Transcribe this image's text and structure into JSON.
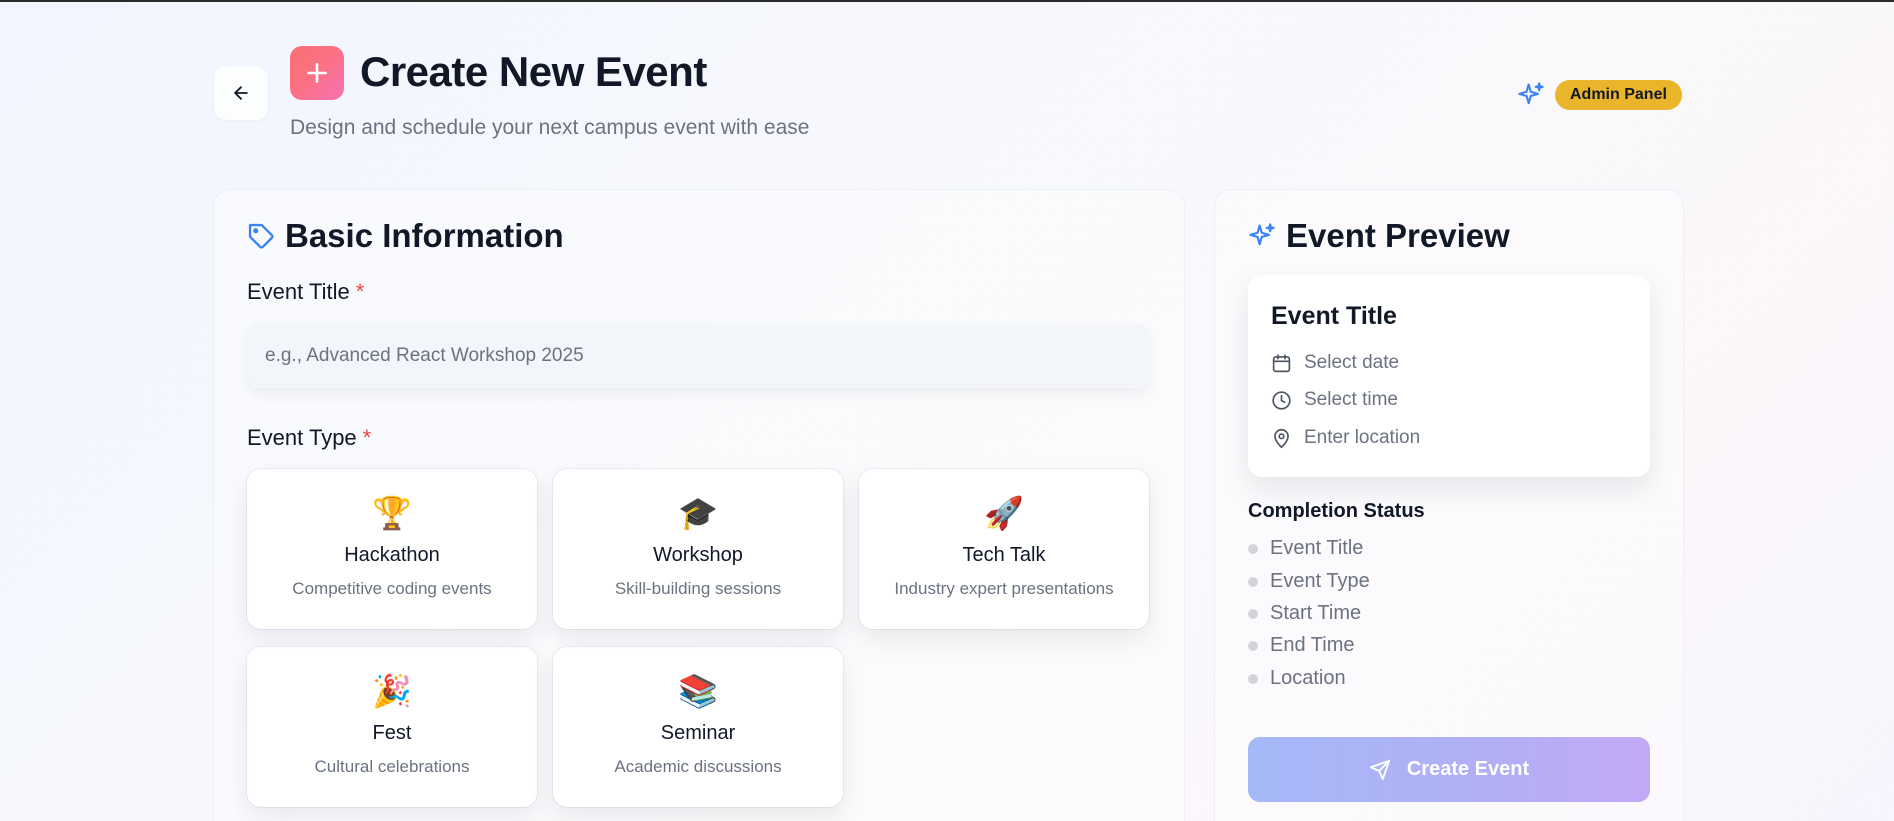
{
  "header": {
    "title": "Create New Event",
    "subtitle": "Design and schedule your next campus event with ease",
    "admin_badge": "Admin Panel"
  },
  "basic_info": {
    "title": "Basic Information",
    "event_title_label": "Event Title",
    "event_title_placeholder": "e.g., Advanced React Workshop 2025",
    "event_title_value": "",
    "event_type_label": "Event Type",
    "required_mark": "*",
    "event_types": [
      {
        "name": "Hackathon",
        "description": "Competitive coding events",
        "emoji": "🏆",
        "icon": "trophy-icon"
      },
      {
        "name": "Workshop",
        "description": "Skill-building sessions",
        "emoji": "🎓",
        "icon": "graduation-cap-icon"
      },
      {
        "name": "Tech Talk",
        "description": "Industry expert presentations",
        "emoji": "🚀",
        "icon": "rocket-icon"
      },
      {
        "name": "Fest",
        "description": "Cultural celebrations",
        "emoji": "🎉",
        "icon": "party-popper-icon"
      },
      {
        "name": "Seminar",
        "description": "Academic discussions",
        "emoji": "📚",
        "icon": "books-icon"
      }
    ]
  },
  "preview": {
    "title": "Event Preview",
    "card_title": "Event Title",
    "date_placeholder": "Select date",
    "time_placeholder": "Select time",
    "location_placeholder": "Enter location",
    "completion_heading": "Completion Status",
    "completion_items": [
      "Event Title",
      "Event Type",
      "Start Time",
      "End Time",
      "Location"
    ],
    "create_button": "Create Event"
  },
  "colors": {
    "accent_blue": "#3b82f6",
    "badge_yellow": "#eab52b",
    "required_red": "#ef4444",
    "header_icon_gradient_start": "#f87171",
    "header_icon_gradient_end": "#f472b6",
    "create_button_gradient_start": "#a5b8f8",
    "create_button_gradient_end": "#c2a9f5"
  }
}
